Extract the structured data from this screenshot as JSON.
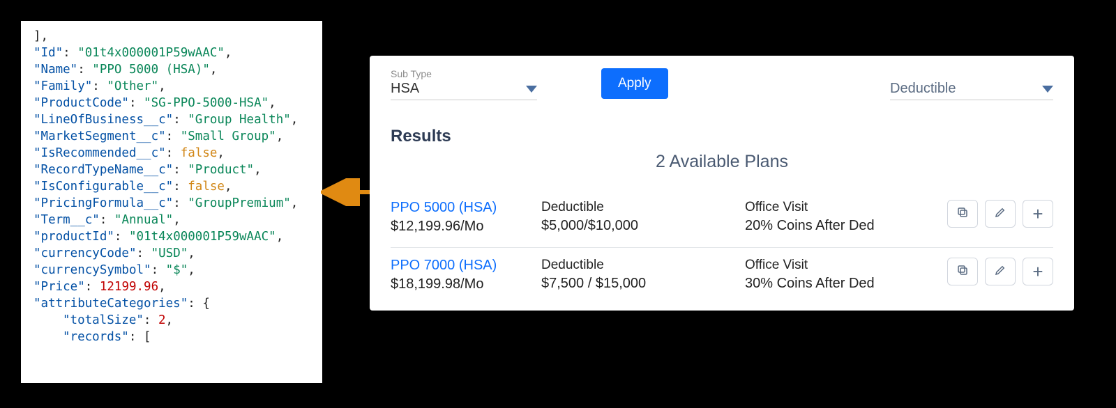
{
  "json_snippet": {
    "lines": [
      {
        "raw": "],",
        "indent": 0
      },
      {
        "key": "Id",
        "val": "01t4x000001P59wAAC",
        "t": "string"
      },
      {
        "key": "Name",
        "val": "PPO 5000 (HSA)",
        "t": "string"
      },
      {
        "key": "Family",
        "val": "Other",
        "t": "string"
      },
      {
        "key": "ProductCode",
        "val": "SG-PPO-5000-HSA",
        "t": "string"
      },
      {
        "key": "LineOfBusiness__c",
        "val": "Group Health",
        "t": "string"
      },
      {
        "key": "MarketSegment__c",
        "val": "Small Group",
        "t": "string"
      },
      {
        "key": "IsRecommended__c",
        "val": "false",
        "t": "kw"
      },
      {
        "key": "RecordTypeName__c",
        "val": "Product",
        "t": "string"
      },
      {
        "key": "IsConfigurable__c",
        "val": "false",
        "t": "kw"
      },
      {
        "key": "PricingFormula__c",
        "val": "GroupPremium",
        "t": "string"
      },
      {
        "key": "Term__c",
        "val": "Annual",
        "t": "string"
      },
      {
        "key": "productId",
        "val": "01t4x000001P59wAAC",
        "t": "string"
      },
      {
        "key": "currencyCode",
        "val": "USD",
        "t": "string"
      },
      {
        "key": "currencySymbol",
        "val": "$",
        "t": "string"
      },
      {
        "key": "Price",
        "val": "12199.96",
        "t": "num"
      },
      {
        "key": "attributeCategories",
        "val": "{",
        "t": "obj"
      },
      {
        "key": "totalSize",
        "val": "2",
        "t": "num",
        "indent": 1,
        "trail": ","
      },
      {
        "key": "records",
        "val": "[",
        "t": "obj",
        "indent": 1,
        "trail": ""
      }
    ]
  },
  "filters": {
    "subtype_label": "Sub Type",
    "subtype_value": "HSA",
    "apply_label": "Apply",
    "sort_value": "Deductible"
  },
  "results": {
    "heading": "Results",
    "available": "2 Available Plans",
    "plans": [
      {
        "name": "PPO 5000 (HSA)",
        "price": "$12,199.96/Mo",
        "deductible_label": "Deductible",
        "deductible_value": "$5,000/$10,000",
        "visit_label": "Office Visit",
        "visit_value": "20% Coins After Ded"
      },
      {
        "name": "PPO 7000 (HSA)",
        "price": "$18,199.98/Mo",
        "deductible_label": "Deductible",
        "deductible_value": "$7,500 / $15,000",
        "visit_label": "Office Visit",
        "visit_value": "30% Coins After Ded"
      }
    ]
  }
}
